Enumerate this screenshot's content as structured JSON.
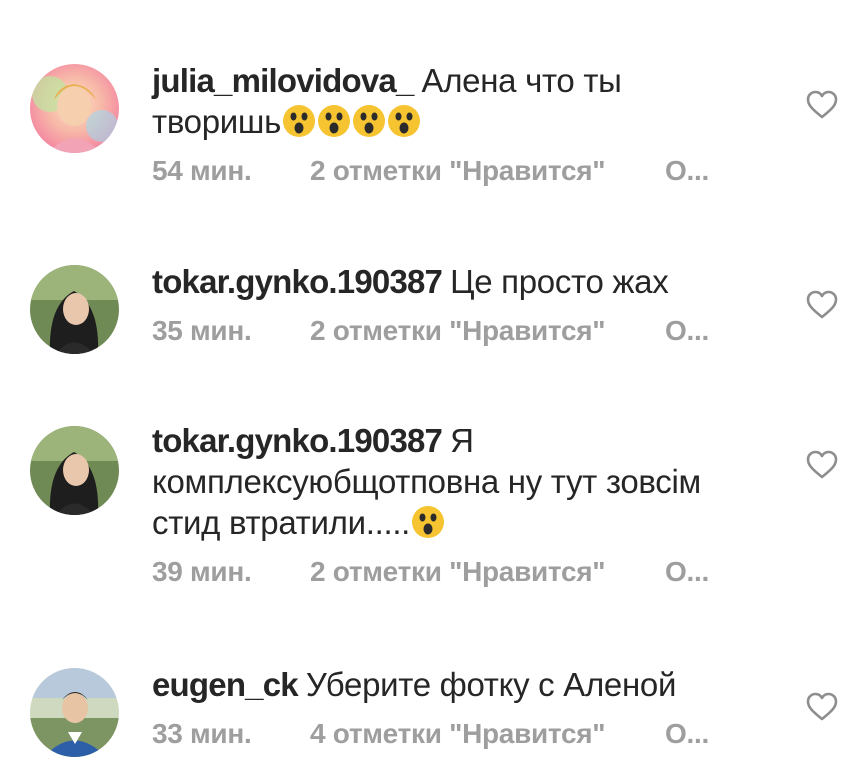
{
  "comments": [
    {
      "username": "julia_milovidova_",
      "text_line1": "Алена что ты",
      "text_line2": "творишь",
      "time": "54 мин.",
      "likes": "2 отметки \"Нравится\"",
      "reply": "О...",
      "emoji_count": 4
    },
    {
      "username": "tokar.gynko.190387",
      "text_line1": "Це просто жах",
      "time": "35 мин.",
      "likes": "2 отметки \"Нравится\"",
      "reply": "О..."
    },
    {
      "username": "tokar.gynko.190387",
      "text_line1": "Я",
      "text_line2": "комплексуюбщотповна ну тут зовсім",
      "text_line3": "стид втратили.....",
      "time": "39 мин.",
      "likes": "2 отметки \"Нравится\"",
      "reply": "О...",
      "emoji_count": 1
    },
    {
      "username": "eugen_ck",
      "text_line1": "Уберите фотку с Аленой",
      "time": "33 мин.",
      "likes": "4 отметки \"Нравится\"",
      "reply": "О..."
    }
  ],
  "colors": {
    "text": "#262626",
    "meta": "#9e9e9e",
    "heart": "#8e8e8e",
    "emoji_face": "#f6c430"
  },
  "icons": [
    "like-heart-icon",
    "surprised-face-emoji"
  ]
}
